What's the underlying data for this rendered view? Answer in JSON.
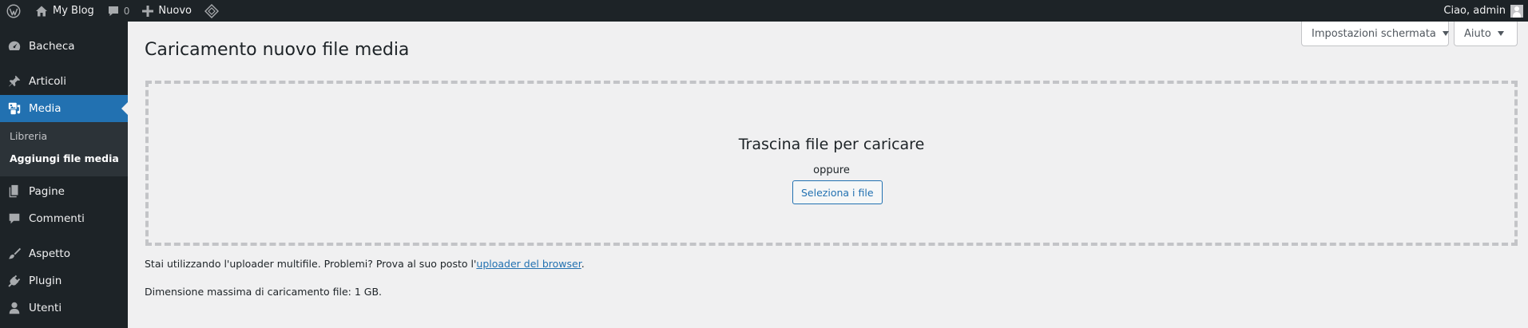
{
  "admin_bar": {
    "site_name": "My Blog",
    "comments_count": "0",
    "new_label": "Nuovo",
    "greeting": "Ciao, admin"
  },
  "sidebar": {
    "items": [
      {
        "label": "Bacheca",
        "icon": "dashboard-icon"
      },
      {
        "label": "Articoli",
        "icon": "pushpin-icon"
      },
      {
        "label": "Media",
        "icon": "media-icon"
      },
      {
        "label": "Pagine",
        "icon": "pages-icon"
      },
      {
        "label": "Commenti",
        "icon": "comment-icon"
      },
      {
        "label": "Aspetto",
        "icon": "brush-icon"
      },
      {
        "label": "Plugin",
        "icon": "plugin-icon"
      },
      {
        "label": "Utenti",
        "icon": "user-icon"
      }
    ],
    "media_submenu": [
      "Libreria",
      "Aggiungi file media"
    ]
  },
  "screen_options_label": "Impostazioni schermata",
  "help_label": "Aiuto",
  "page_title": "Caricamento nuovo file media",
  "uploader": {
    "drop_text": "Trascina file per caricare",
    "or_text": "oppure",
    "select_button": "Seleziona i file"
  },
  "info": {
    "multi_uploader_prefix": "Stai utilizzando l'uploader multifile. Problemi? Prova al suo posto l'",
    "browser_uploader_link": "uploader del browser",
    "multi_uploader_suffix": ".",
    "max_size": "Dimensione massima di caricamento file: 1 GB."
  },
  "colors": {
    "admin_bar_bg": "#1d2327",
    "sidebar_bg": "#1d2327",
    "submenu_bg": "#2c3338",
    "accent": "#2271b1",
    "page_bg": "#f0f0f1"
  }
}
